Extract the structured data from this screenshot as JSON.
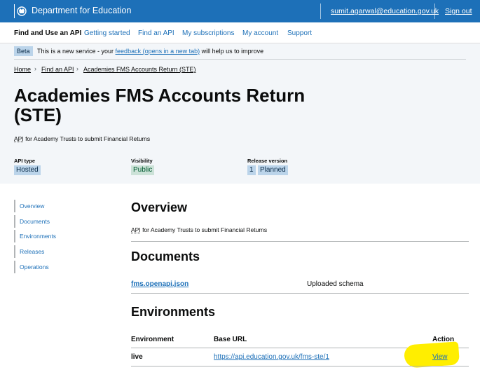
{
  "header": {
    "brand": "Department for Education",
    "user_email": "sumit.agarwal@education.gov.uk",
    "sign_out": "Sign out"
  },
  "nav": {
    "service_name": "Find and Use an API",
    "links": [
      "Getting started",
      "Find an API",
      "My subscriptions",
      "My account",
      "Support"
    ]
  },
  "phase_banner": {
    "tag": "Beta",
    "text_before": "This is a new service - your ",
    "link": "feedback (opens in a new tab)",
    "text_after": " will help us to improve"
  },
  "breadcrumbs": [
    "Home",
    "Find an API",
    "Academies FMS Accounts Return (STE)"
  ],
  "page": {
    "title": "Academies FMS Accounts Return (STE)",
    "subtitle_abbr": "API",
    "subtitle_rest": " for Academy Trusts to submit Financial Returns"
  },
  "meta": {
    "api_type_label": "API type",
    "api_type": "Hosted",
    "visibility_label": "Visibility",
    "visibility": "Public",
    "release_label": "Release version",
    "release_number": "1",
    "release_status": "Planned"
  },
  "sidebar": [
    "Overview",
    "Documents",
    "Environments",
    "Releases",
    "Operations"
  ],
  "overview": {
    "heading": "Overview",
    "text_abbr": "API",
    "text_rest": " for Academy Trusts to submit Financial Returns"
  },
  "documents": {
    "heading": "Documents",
    "file": "fms.openapi.json",
    "description": "Uploaded schema"
  },
  "environments": {
    "heading": "Environments",
    "columns": [
      "Environment",
      "Base URL",
      "Action"
    ],
    "rows": [
      {
        "environment": "live",
        "base_url": "https://api.education.gov.uk/fms-ste/1",
        "action": "View"
      }
    ],
    "highlight_color": "#ffee00"
  },
  "colors": {
    "header_blue": "#1d70b8",
    "link_blue": "#1d70b8",
    "banner_background": "#f3f6f9"
  }
}
